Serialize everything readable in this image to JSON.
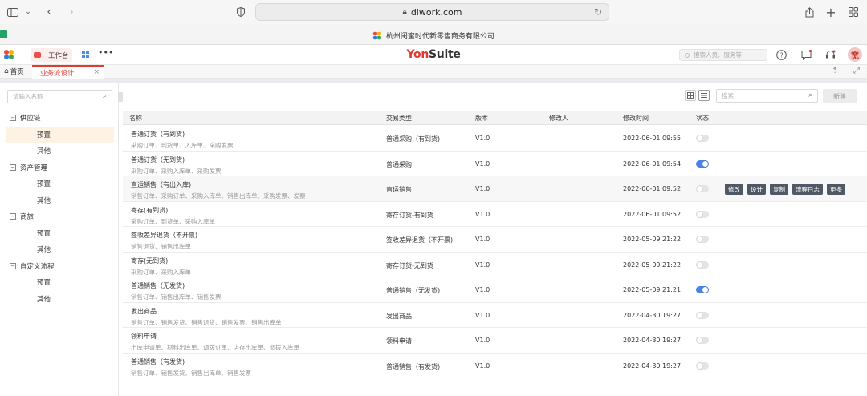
{
  "browser": {
    "url": "diwork.com",
    "tab_title": "杭州闺蜜时代新零售商务有限公司"
  },
  "app": {
    "workspace_label": "工作台",
    "logo_primary": "Yon",
    "logo_secondary": "Suite",
    "search_placeholder": "搜索人员、服务等",
    "avatar_text": "宽"
  },
  "tabs": {
    "home": "首页",
    "active": "业务流设计"
  },
  "sidebar": {
    "search_placeholder": "请输入名称",
    "groups": [
      {
        "label": "供应链",
        "expand": "−",
        "children": [
          "预置",
          "其他"
        ]
      },
      {
        "label": "资产管理",
        "expand": "−",
        "children": [
          "预置",
          "其他"
        ]
      },
      {
        "label": "商旅",
        "expand": "−",
        "children": [
          "预置",
          "其他"
        ]
      },
      {
        "label": "自定义流程",
        "expand": "−",
        "children": [
          "预置",
          "其他"
        ]
      }
    ]
  },
  "toolbar": {
    "search_placeholder": "搜索",
    "new_button": "新建"
  },
  "table": {
    "headers": {
      "name": "名称",
      "type": "交易类型",
      "version": "版本",
      "modifier": "修改人",
      "modified_time": "修改时间",
      "status": "状态"
    },
    "rows": [
      {
        "name": "普通订货（有到货)",
        "sub": "采购订单、到货单、入库单、采购发票",
        "type": "普通采购（有到货)",
        "version": "V1.0",
        "modifier": "",
        "time": "2022-06-01 09:55",
        "enabled": false
      },
      {
        "name": "普通订货（无到货)",
        "sub": "采购订单、采购入库单、采购发票",
        "type": "普通采购",
        "version": "V1.0",
        "modifier": "",
        "time": "2022-06-01 09:54",
        "enabled": true
      },
      {
        "name": "直运销售（有出入库)",
        "sub": "销售订单、采购订单、采购入库单、销售出库单、采购发票、发票",
        "type": "直运销售",
        "version": "V1.0",
        "modifier": "",
        "time": "2022-06-01 09:52",
        "enabled": false
      },
      {
        "name": "寄存(有到货)",
        "sub": "采购订单、到货单、采购入库单",
        "type": "寄存订货-有到货",
        "version": "V1.0",
        "modifier": "",
        "time": "2022-06-01 09:52",
        "enabled": false
      },
      {
        "name": "签收差异退货（不开票)",
        "sub": "销售退货、销售出库单",
        "type": "签收差异退货（不开票)",
        "version": "V1.0",
        "modifier": "",
        "time": "2022-05-09 21:22",
        "enabled": false
      },
      {
        "name": "寄存(无到货)",
        "sub": "采购订单、采购入库单",
        "type": "寄存订货-无到货",
        "version": "V1.0",
        "modifier": "",
        "time": "2022-05-09 21:22",
        "enabled": false
      },
      {
        "name": "普通销售（无发货)",
        "sub": "销售订单、销售出库单、销售发票",
        "type": "普通销售（无发货)",
        "version": "V1.0",
        "modifier": "",
        "time": "2022-05-09 21:21",
        "enabled": true
      },
      {
        "name": "发出商品",
        "sub": "销售订单、销售发货、销售退货、销售发票、销售出库单",
        "type": "发出商品",
        "version": "V1.0",
        "modifier": "",
        "time": "2022-04-30 19:27",
        "enabled": false
      },
      {
        "name": "领料申请",
        "sub": "出库申请单、材料出库单、调拨订单、店存出库单、调拨入库单",
        "type": "领料申请",
        "version": "V1.0",
        "modifier": "",
        "time": "2022-04-30 19:27",
        "enabled": false
      },
      {
        "name": "普通销售（有发货)",
        "sub": "销售订单、销售发货、销售出库单、销售发票",
        "type": "普通销售（有发货)",
        "version": "V1.0",
        "modifier": "",
        "time": "2022-04-30 19:27",
        "enabled": false
      }
    ],
    "row_actions": [
      "修改",
      "设计",
      "复制",
      "流程日志",
      "更多"
    ],
    "hover_row_index": 2
  },
  "colors": {
    "brand_red": "#e23a2e",
    "toggle_on": "#4c82e8",
    "selected_tree": "#fdf2e3",
    "action_button": "#505865"
  },
  "icons": [
    "sidebar-toggle-icon",
    "chevron-down-icon",
    "back-arrow-icon",
    "forward-arrow-icon",
    "shield-icon",
    "lock-icon",
    "reload-icon",
    "share-icon",
    "plus-icon",
    "tab-grid-icon",
    "app-logo-icon",
    "grid-icon",
    "more-icon",
    "help-icon",
    "message-icon",
    "headset-icon",
    "home-icon",
    "close-icon",
    "upload-icon",
    "expand-icon",
    "search-icon",
    "card-view-icon",
    "list-view-icon"
  ]
}
